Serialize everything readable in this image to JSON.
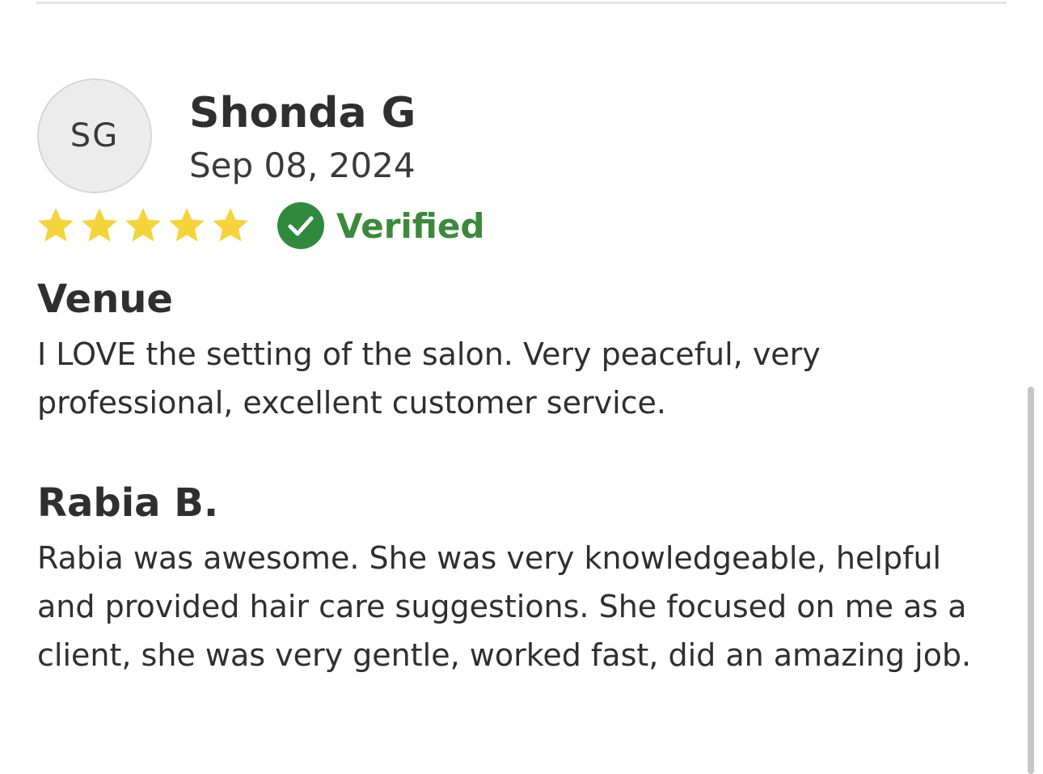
{
  "review": {
    "avatar_initials": "SG",
    "reviewer_name": "Shonda G",
    "date": "Sep 08, 2024",
    "rating": 5,
    "rating_max": 5,
    "star_color": "#f5d33a",
    "verified_label": "Verified",
    "verified_color": "#3a8a3a",
    "sections": [
      {
        "title": "Venue",
        "text": "I LOVE the setting of the salon. Very peaceful, very professional, excellent customer service."
      },
      {
        "title": "Rabia B.",
        "text": "Rabia was awesome. She was very knowledgeable, helpful and provided hair care suggestions. She focused on me as a client, she was very gentle, worked fast, did an amazing job."
      }
    ]
  },
  "icons": {
    "star": "star-icon",
    "verified": "check-circle-icon"
  }
}
